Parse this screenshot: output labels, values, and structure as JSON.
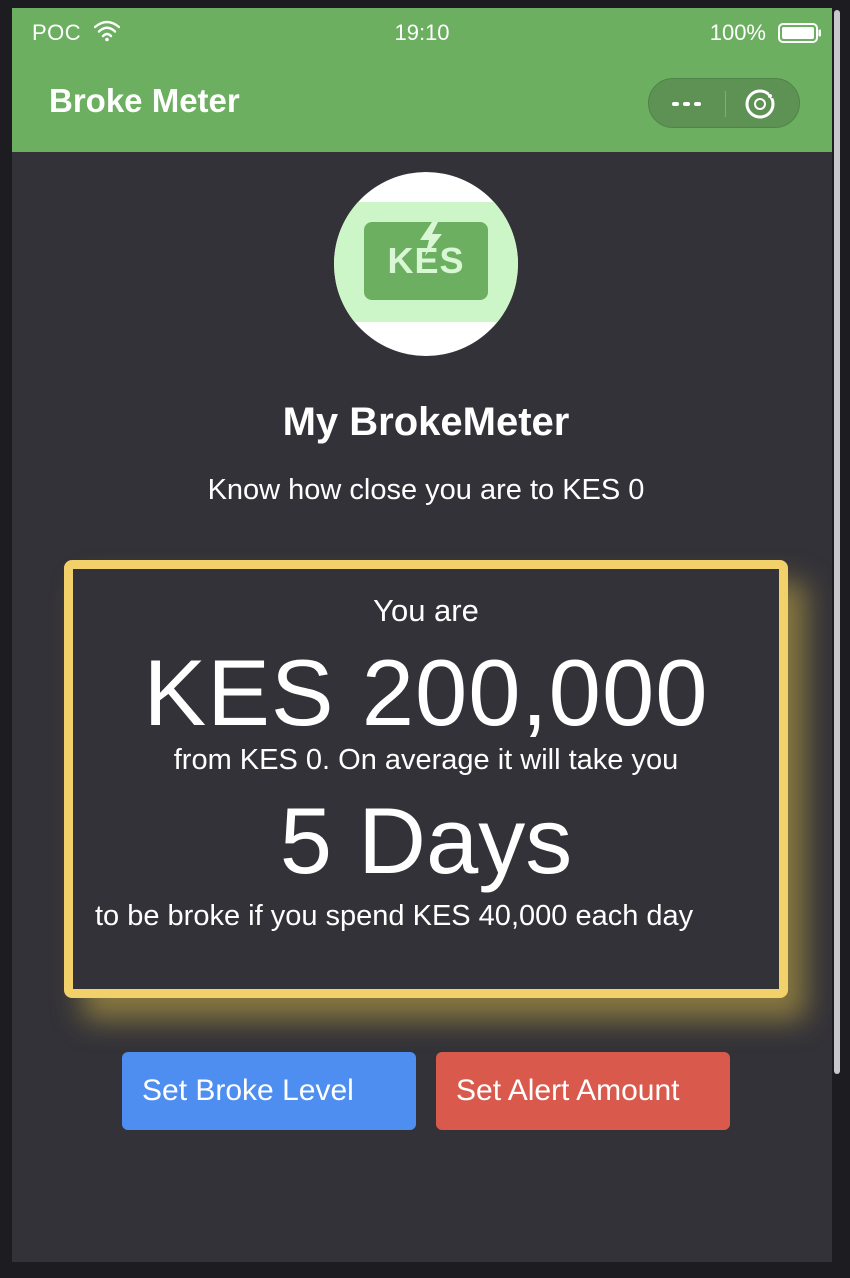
{
  "status_bar": {
    "carrier": "POC",
    "time": "19:10",
    "battery": "100%"
  },
  "header": {
    "title": "Broke Meter",
    "more_icon": "more-dots-icon",
    "close_icon": "close-miniprogram-icon",
    "background": "#6caf61"
  },
  "logo": {
    "text": "KES",
    "icon": "banknote-bolt-icon"
  },
  "main": {
    "title": "My BrokeMeter",
    "subtitle": "Know how close you are to KES 0"
  },
  "meter": {
    "intro": "You are",
    "amount": "KES 200,000",
    "from_text": "from KES 0. On average it will take you",
    "duration": "5 Days",
    "outro": "to be broke if you spend KES 40,000 each day",
    "border_color": "#f2d16a"
  },
  "buttons": {
    "set_broke_level": "Set Broke Level",
    "set_alert_amount": "Set Alert Amount",
    "broke_color": "#4e8ef0",
    "alert_color": "#d95a4d"
  }
}
